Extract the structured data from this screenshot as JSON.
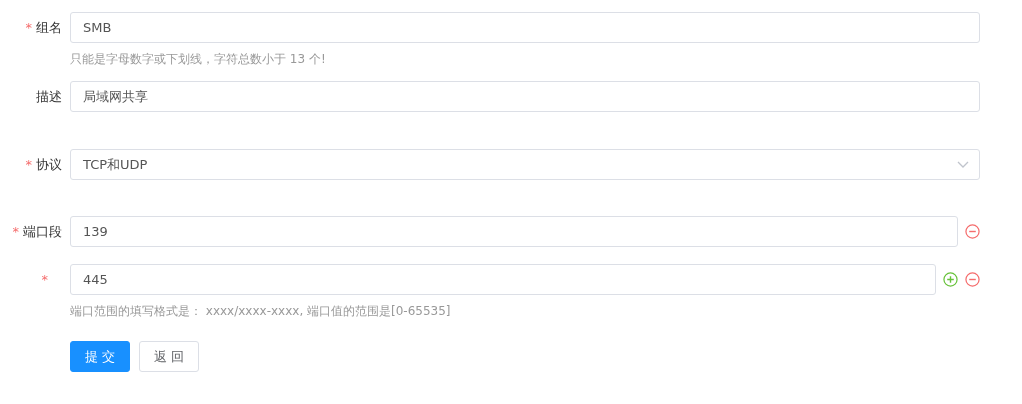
{
  "fields": [
    {
      "kind": "input",
      "mark": "*",
      "label": "组名",
      "value": "SMB",
      "hint": "只能是字母数字或下划线，字符总数小于 13 个!"
    },
    {
      "kind": "input",
      "label": "描述",
      "value": "局域网共享"
    },
    {
      "kind": "select",
      "mark": "*",
      "label": "协议",
      "value": "TCP和UDP"
    }
  ],
  "ports": {
    "rows": [
      {
        "mark": "*",
        "label": "端口段",
        "value": "139",
        "actions": [
          {
            "kind": "remove"
          }
        ]
      },
      {
        "mark": "*",
        "value": "445",
        "actions": [
          {
            "kind": "add"
          },
          {
            "kind": "remove"
          }
        ]
      }
    ],
    "hint": "端口范围的填写格式是： xxxx/xxxx-xxxx, 端口值的范围是[0-65535]"
  },
  "buttons": [
    {
      "label": "提 交",
      "primary": true
    },
    {
      "label": "返 回",
      "primary": false
    }
  ]
}
